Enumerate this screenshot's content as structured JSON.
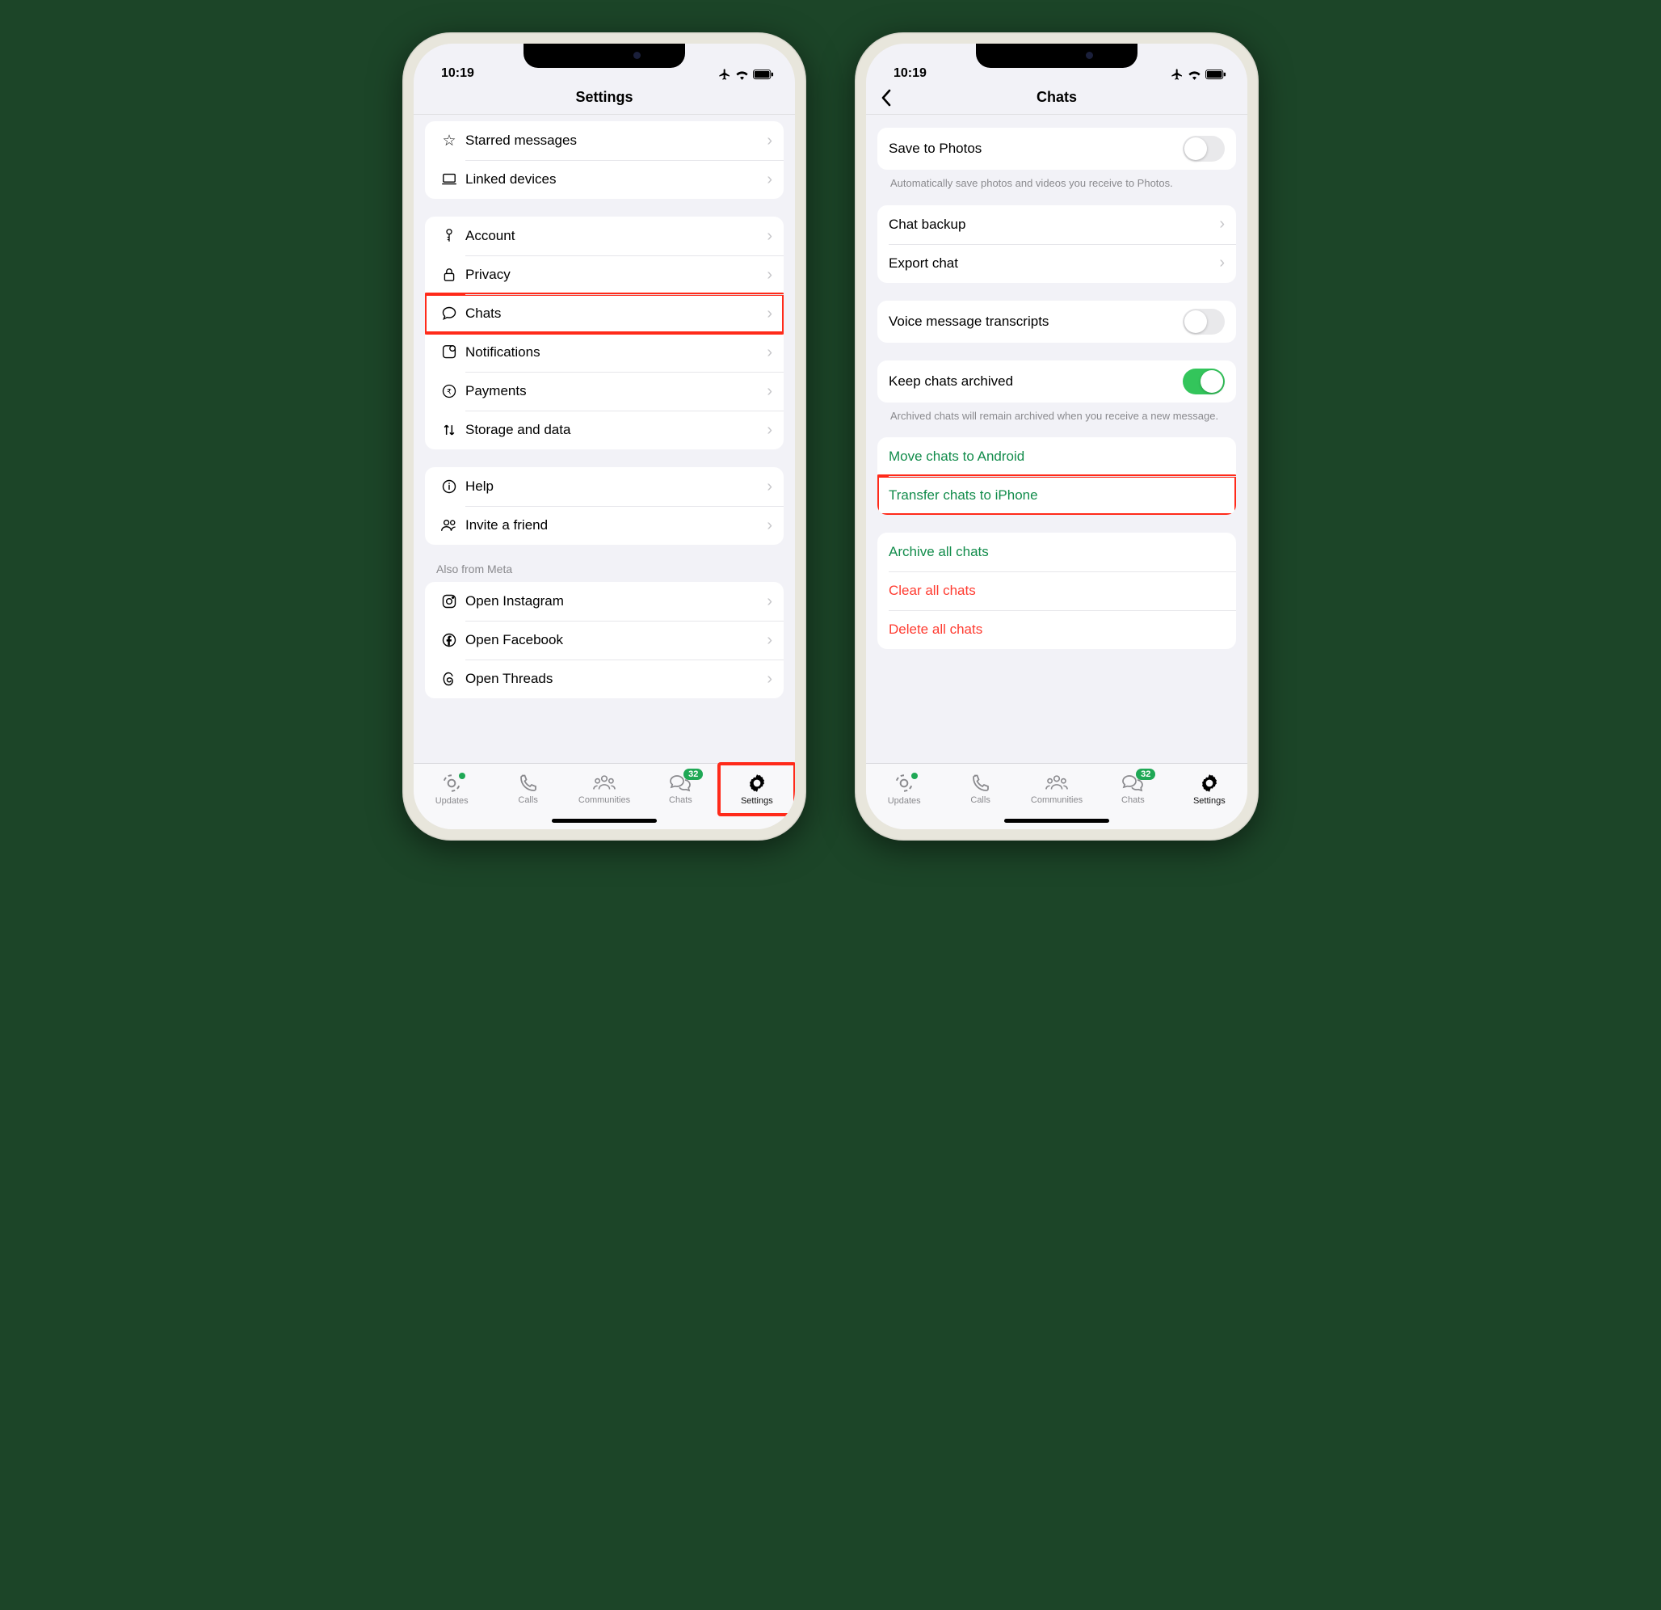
{
  "status": {
    "time": "10:19"
  },
  "left": {
    "title": "Settings",
    "group1": [
      {
        "label": "Starred messages",
        "icon": "star"
      },
      {
        "label": "Linked devices",
        "icon": "laptop"
      }
    ],
    "group2": [
      {
        "label": "Account",
        "icon": "key"
      },
      {
        "label": "Privacy",
        "icon": "lock"
      },
      {
        "label": "Chats",
        "icon": "chat",
        "highlight": true
      },
      {
        "label": "Notifications",
        "icon": "bell"
      },
      {
        "label": "Payments",
        "icon": "rupee"
      },
      {
        "label": "Storage and data",
        "icon": "updown"
      }
    ],
    "group3": [
      {
        "label": "Help",
        "icon": "info"
      },
      {
        "label": "Invite a friend",
        "icon": "people"
      }
    ],
    "meta_header": "Also from Meta",
    "group4": [
      {
        "label": "Open Instagram",
        "icon": "instagram"
      },
      {
        "label": "Open Facebook",
        "icon": "facebook"
      },
      {
        "label": "Open Threads",
        "icon": "threads"
      }
    ]
  },
  "right": {
    "title": "Chats",
    "save_photos": {
      "label": "Save to Photos",
      "footer": "Automatically save photos and videos you receive to Photos."
    },
    "backup": [
      {
        "label": "Chat backup"
      },
      {
        "label": "Export chat"
      }
    ],
    "voice": {
      "label": "Voice message transcripts"
    },
    "archive": {
      "label": "Keep chats archived",
      "footer": "Archived chats will remain archived when you receive a new message."
    },
    "transfer": [
      {
        "label": "Move chats to Android"
      },
      {
        "label": "Transfer chats to iPhone",
        "highlight": true
      }
    ],
    "danger": [
      {
        "label": "Archive all chats",
        "style": "green"
      },
      {
        "label": "Clear all chats",
        "style": "red"
      },
      {
        "label": "Delete all chats",
        "style": "red"
      }
    ]
  },
  "tabs": {
    "items": [
      "Updates",
      "Calls",
      "Communities",
      "Chats",
      "Settings"
    ],
    "badge": "32",
    "active_left": "Settings",
    "active_right": "Settings"
  }
}
